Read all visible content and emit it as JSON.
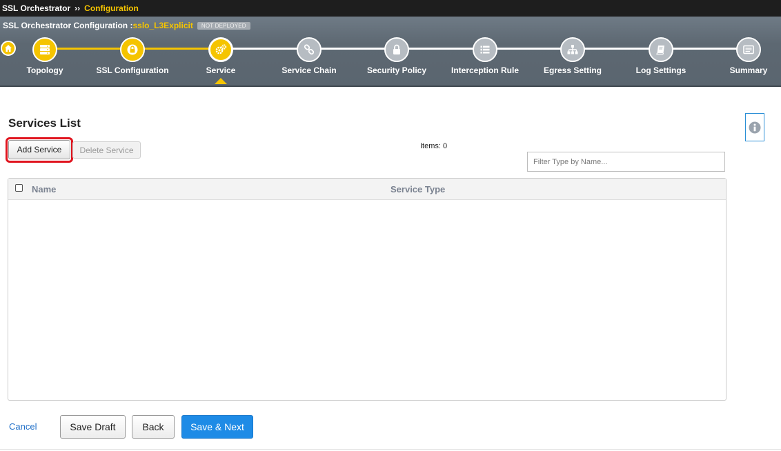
{
  "breadcrumb": {
    "root": "SSL Orchestrator",
    "separator": "››",
    "current": "Configuration"
  },
  "config": {
    "prefix": "SSL Orchestrator Configuration :",
    "name": "sslo_L3Explicit",
    "status": "NOT DEPLOYED"
  },
  "wizard": {
    "steps": [
      {
        "label": "Topology",
        "state": "done",
        "icon": "server-icon"
      },
      {
        "label": "SSL Configuration",
        "state": "done",
        "icon": "lock-badge-icon"
      },
      {
        "label": "Service",
        "state": "current",
        "icon": "gears-icon"
      },
      {
        "label": "Service Chain",
        "state": "todo",
        "icon": "link-icon"
      },
      {
        "label": "Security Policy",
        "state": "todo",
        "icon": "lock-icon"
      },
      {
        "label": "Interception Rule",
        "state": "todo",
        "icon": "list-icon"
      },
      {
        "label": "Egress Setting",
        "state": "todo",
        "icon": "sitemap-icon"
      },
      {
        "label": "Log Settings",
        "state": "todo",
        "icon": "book-icon"
      },
      {
        "label": "Summary",
        "state": "todo",
        "icon": "summary-icon"
      }
    ]
  },
  "services": {
    "title": "Services List",
    "add_label": "Add Service",
    "delete_label": "Delete Service",
    "items_label": "Items:",
    "items_count": "0",
    "filter_placeholder": "Filter Type by Name...",
    "columns": {
      "name": "Name",
      "type": "Service Type"
    },
    "rows": []
  },
  "footer": {
    "cancel": "Cancel",
    "save_draft": "Save Draft",
    "back": "Back",
    "save_next": "Save & Next"
  },
  "colors": {
    "accent": "#f5c400",
    "primary_button": "#1e8be6",
    "highlight": "#e0141e",
    "header_bg": "#5d6872"
  }
}
